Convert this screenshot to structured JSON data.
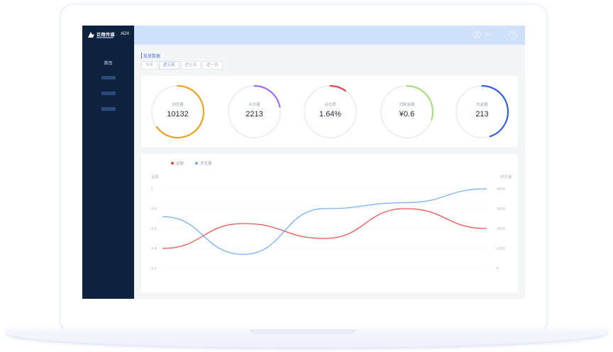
{
  "colors": {
    "sidebar": "#0e213f",
    "topbar": "#cfe0fb",
    "accent": "#4b78d3"
  },
  "sidebar": {
    "logo_text": "巨翔传媒",
    "logo_suffix": "ADX",
    "nav": [
      {
        "label": "首页"
      },
      {
        "label": ""
      },
      {
        "label": ""
      },
      {
        "label": ""
      }
    ]
  },
  "header": {
    "user_icon": "user-circle-icon",
    "username": "user",
    "help_icon": "question-circle-icon"
  },
  "main": {
    "section_title": "投放数据",
    "tabs": [
      {
        "label": "今天",
        "active": false
      },
      {
        "label": "近三天",
        "active": true
      },
      {
        "label": "近七天",
        "active": false
      },
      {
        "label": "近一月",
        "active": false
      }
    ],
    "stats": [
      {
        "label": "浏览量",
        "value": "10132",
        "color": "#f0a020",
        "progress": 0.65
      },
      {
        "label": "点击量",
        "value": "2213",
        "color": "#a46ee8",
        "progress": 0.22
      },
      {
        "label": "点击率",
        "value": "1.64%",
        "color": "#e0474c",
        "progress": 0.1
      },
      {
        "label": "消耗金额",
        "value": "¥0.6",
        "color": "#a6e07a",
        "progress": 0.3
      },
      {
        "label": "总金额",
        "value": "213",
        "color": "#3760e0",
        "progress": 0.45
      }
    ]
  },
  "chart_data": {
    "type": "line",
    "legend_position": "top-left",
    "grid": true,
    "x": [
      0,
      1,
      2,
      3,
      4,
      5
    ],
    "left_axis": {
      "label": "金额",
      "ticks": [
        "1",
        "0.8",
        "0.6",
        "0.4",
        "0.2"
      ],
      "range": [
        0.2,
        1
      ]
    },
    "right_axis": {
      "label": "浏览量",
      "ticks": [
        "4000",
        "3000",
        "2000",
        "1000",
        "0"
      ],
      "range": [
        0,
        4000
      ]
    },
    "series": [
      {
        "name": "金额",
        "color": "#e84545",
        "axis": "left",
        "values": [
          0.4,
          0.65,
          0.5,
          0.8,
          0.6
        ]
      },
      {
        "name": "浏览量",
        "color": "#6fa6f2",
        "axis": "right",
        "values": [
          2600,
          700,
          3000,
          3300,
          4000
        ]
      }
    ]
  }
}
